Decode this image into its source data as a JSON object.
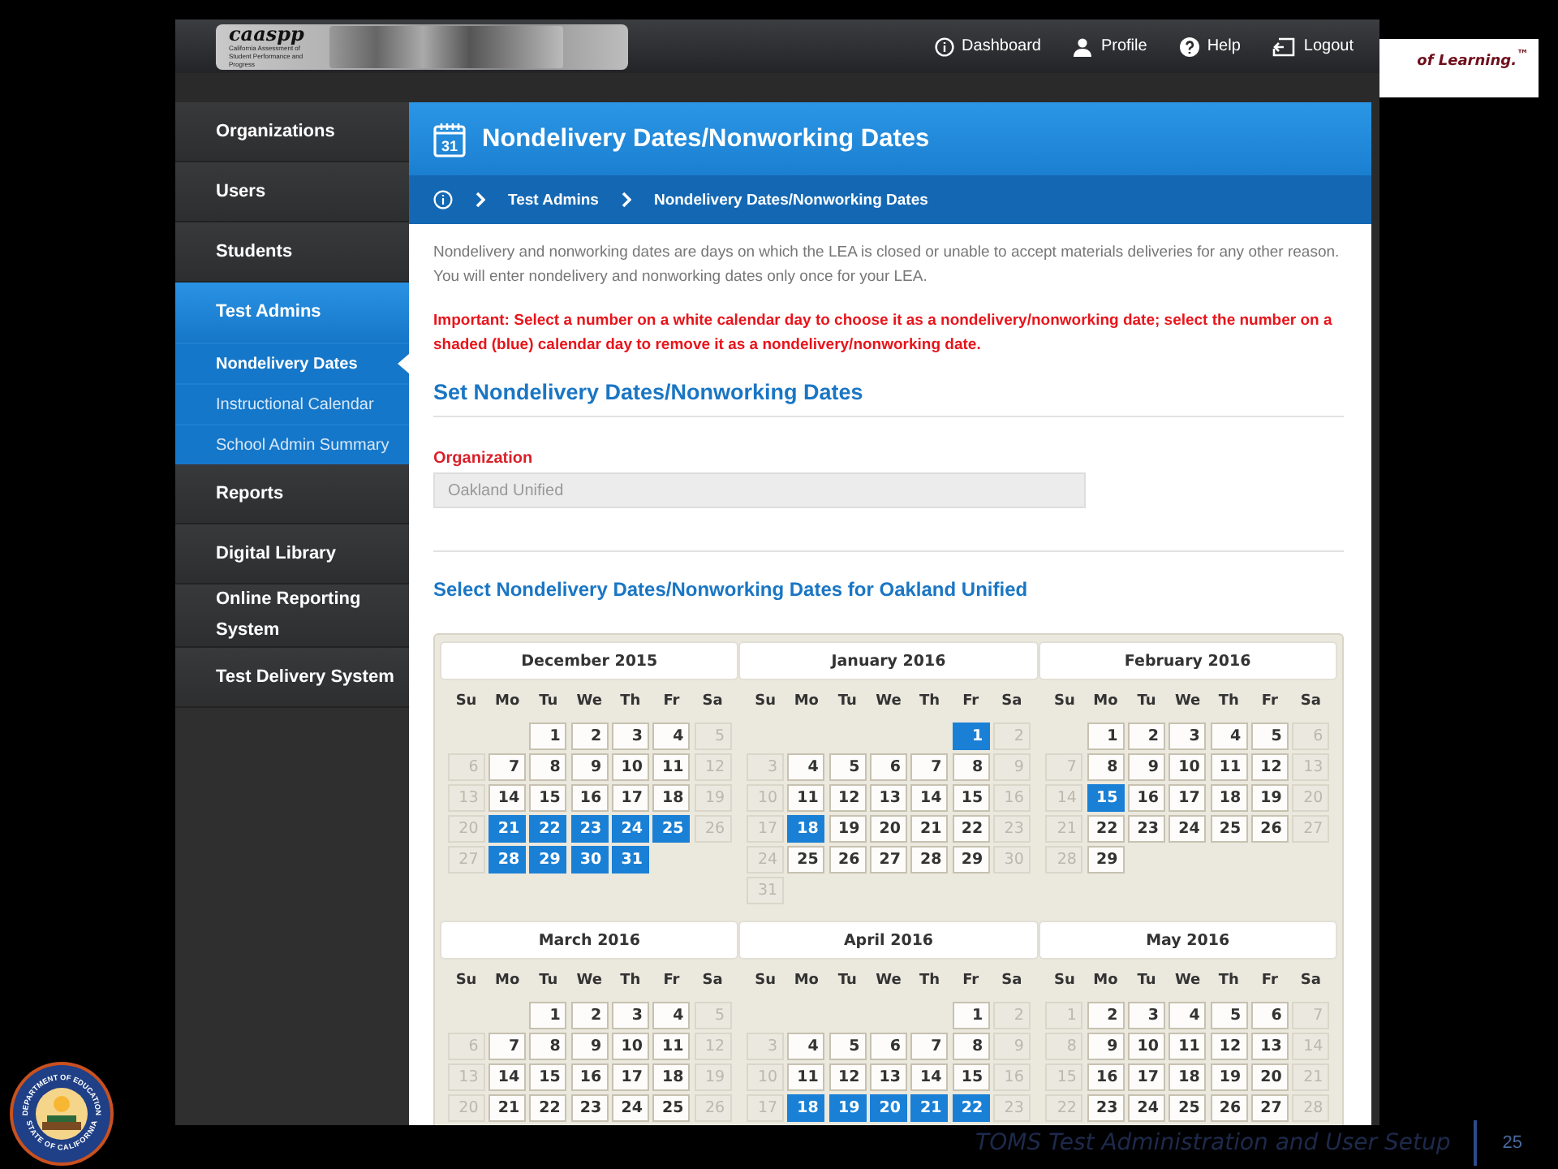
{
  "slide": {
    "brand_tagline": "of Learning.$^{™}$",
    "footer": "TOMS Test Administration and User Setup",
    "page_number": "25",
    "seal": {
      "top": "DEPARTMENT OF EDUCATION",
      "bottom": "STATE OF CALIFORNIA"
    }
  },
  "header": {
    "logo": "caaspp",
    "logo_subtitle": "California Assessment of Student Performance and Progress",
    "nav": [
      {
        "label": "Dashboard",
        "kind": "dashboard"
      },
      {
        "label": "Profile",
        "kind": "profile"
      },
      {
        "label": "Help",
        "kind": "help"
      },
      {
        "label": "Logout",
        "kind": "logout"
      }
    ]
  },
  "sidebar": {
    "items": [
      {
        "label": "Organizations",
        "selected": false
      },
      {
        "label": "Users",
        "selected": false
      },
      {
        "label": "Students",
        "selected": false
      },
      {
        "label": "Test Admins",
        "selected": true,
        "expanded": true,
        "children": [
          {
            "label": "Nondelivery Dates",
            "selected": true
          },
          {
            "label": "Instructional Calendar",
            "selected": false
          },
          {
            "label": "School Admin Summary",
            "selected": false
          }
        ]
      },
      {
        "label": "Reports",
        "selected": false
      },
      {
        "label": "Digital Library",
        "selected": false
      },
      {
        "label": "Online Reporting System",
        "selected": false
      },
      {
        "label": "Test Delivery System",
        "selected": false
      }
    ]
  },
  "page": {
    "title": "Nondelivery Dates/Nonworking Dates",
    "title_icon_day": "31",
    "breadcrumb": [
      "Test Admins",
      "Nondelivery Dates/Nonworking Dates"
    ],
    "intro": "Nondelivery and nonworking dates are days on which the LEA is closed or unable to accept materials deliveries for any other reason. You will enter nondelivery and nonworking dates only once for your LEA.",
    "important": "Important: Select a number on a white calendar day to choose it as a nondelivery/nonworking date; select the number on a shaded (blue) calendar day to remove it as a nondelivery/nonworking date.",
    "section_title": "Set Nondelivery Dates/Nonworking Dates",
    "organization": {
      "label": "Organization",
      "value": "Oakland Unified",
      "disabled": true
    },
    "calendar_title": "Select Nondelivery Dates/Nonworking Dates for Oakland Unified",
    "calendar": {
      "months": [
        {
          "title": "December 2015",
          "day_names": [
            "Su",
            "Mo",
            "Tu",
            "We",
            "Th",
            "Fr",
            "Sa"
          ],
          "weeks": [
            [
              {
                "kind": "blank"
              },
              {
                "kind": "blank"
              },
              {
                "kind": "day",
                "day": "1",
                "disabled": false,
                "selected": false
              },
              {
                "kind": "day",
                "day": "2",
                "disabled": false,
                "selected": false
              },
              {
                "kind": "day",
                "day": "3",
                "disabled": false,
                "selected": false
              },
              {
                "kind": "day",
                "day": "4",
                "disabled": false,
                "selected": false
              },
              {
                "kind": "day",
                "day": "5",
                "disabled": true,
                "selected": false
              }
            ],
            [
              {
                "kind": "day",
                "day": "6",
                "disabled": true,
                "selected": false
              },
              {
                "kind": "day",
                "day": "7",
                "disabled": false,
                "selected": false
              },
              {
                "kind": "day",
                "day": "8",
                "disabled": false,
                "selected": false
              },
              {
                "kind": "day",
                "day": "9",
                "disabled": false,
                "selected": false
              },
              {
                "kind": "day",
                "day": "10",
                "disabled": false,
                "selected": false
              },
              {
                "kind": "day",
                "day": "11",
                "disabled": false,
                "selected": false
              },
              {
                "kind": "day",
                "day": "12",
                "disabled": true,
                "selected": false
              }
            ],
            [
              {
                "kind": "day",
                "day": "13",
                "disabled": true,
                "selected": false
              },
              {
                "kind": "day",
                "day": "14",
                "disabled": false,
                "selected": false
              },
              {
                "kind": "day",
                "day": "15",
                "disabled": false,
                "selected": false
              },
              {
                "kind": "day",
                "day": "16",
                "disabled": false,
                "selected": false
              },
              {
                "kind": "day",
                "day": "17",
                "disabled": false,
                "selected": false
              },
              {
                "kind": "day",
                "day": "18",
                "disabled": false,
                "selected": false
              },
              {
                "kind": "day",
                "day": "19",
                "disabled": true,
                "selected": false
              }
            ],
            [
              {
                "kind": "day",
                "day": "20",
                "disabled": true,
                "selected": false
              },
              {
                "kind": "day",
                "day": "21",
                "disabled": false,
                "selected": true
              },
              {
                "kind": "day",
                "day": "22",
                "disabled": false,
                "selected": true
              },
              {
                "kind": "day",
                "day": "23",
                "disabled": false,
                "selected": true
              },
              {
                "kind": "day",
                "day": "24",
                "disabled": false,
                "selected": true
              },
              {
                "kind": "day",
                "day": "25",
                "disabled": false,
                "selected": true
              },
              {
                "kind": "day",
                "day": "26",
                "disabled": true,
                "selected": false
              }
            ],
            [
              {
                "kind": "day",
                "day": "27",
                "disabled": true,
                "selected": false
              },
              {
                "kind": "day",
                "day": "28",
                "disabled": false,
                "selected": true
              },
              {
                "kind": "day",
                "day": "29",
                "disabled": false,
                "selected": true
              },
              {
                "kind": "day",
                "day": "30",
                "disabled": false,
                "selected": true
              },
              {
                "kind": "day",
                "day": "31",
                "disabled": false,
                "selected": true
              }
            ]
          ]
        },
        {
          "title": "January 2016",
          "day_names": [
            "Su",
            "Mo",
            "Tu",
            "We",
            "Th",
            "Fr",
            "Sa"
          ],
          "weeks": [
            [
              {
                "kind": "blank"
              },
              {
                "kind": "blank"
              },
              {
                "kind": "blank"
              },
              {
                "kind": "blank"
              },
              {
                "kind": "blank"
              },
              {
                "kind": "day",
                "day": "1",
                "disabled": false,
                "selected": true
              },
              {
                "kind": "day",
                "day": "2",
                "disabled": true,
                "selected": false
              }
            ],
            [
              {
                "kind": "day",
                "day": "3",
                "disabled": true,
                "selected": false
              },
              {
                "kind": "day",
                "day": "4",
                "disabled": false,
                "selected": false
              },
              {
                "kind": "day",
                "day": "5",
                "disabled": false,
                "selected": false
              },
              {
                "kind": "day",
                "day": "6",
                "disabled": false,
                "selected": false
              },
              {
                "kind": "day",
                "day": "7",
                "disabled": false,
                "selected": false
              },
              {
                "kind": "day",
                "day": "8",
                "disabled": false,
                "selected": false
              },
              {
                "kind": "day",
                "day": "9",
                "disabled": true,
                "selected": false
              }
            ],
            [
              {
                "kind": "day",
                "day": "10",
                "disabled": true,
                "selected": false
              },
              {
                "kind": "day",
                "day": "11",
                "disabled": false,
                "selected": false
              },
              {
                "kind": "day",
                "day": "12",
                "disabled": false,
                "selected": false
              },
              {
                "kind": "day",
                "day": "13",
                "disabled": false,
                "selected": false
              },
              {
                "kind": "day",
                "day": "14",
                "disabled": false,
                "selected": false
              },
              {
                "kind": "day",
                "day": "15",
                "disabled": false,
                "selected": false
              },
              {
                "kind": "day",
                "day": "16",
                "disabled": true,
                "selected": false
              }
            ],
            [
              {
                "kind": "day",
                "day": "17",
                "disabled": true,
                "selected": false
              },
              {
                "kind": "day",
                "day": "18",
                "disabled": false,
                "selected": true
              },
              {
                "kind": "day",
                "day": "19",
                "disabled": false,
                "selected": false
              },
              {
                "kind": "day",
                "day": "20",
                "disabled": false,
                "selected": false
              },
              {
                "kind": "day",
                "day": "21",
                "disabled": false,
                "selected": false
              },
              {
                "kind": "day",
                "day": "22",
                "disabled": false,
                "selected": false
              },
              {
                "kind": "day",
                "day": "23",
                "disabled": true,
                "selected": false
              }
            ],
            [
              {
                "kind": "day",
                "day": "24",
                "disabled": true,
                "selected": false
              },
              {
                "kind": "day",
                "day": "25",
                "disabled": false,
                "selected": false
              },
              {
                "kind": "day",
                "day": "26",
                "disabled": false,
                "selected": false
              },
              {
                "kind": "day",
                "day": "27",
                "disabled": false,
                "selected": false
              },
              {
                "kind": "day",
                "day": "28",
                "disabled": false,
                "selected": false
              },
              {
                "kind": "day",
                "day": "29",
                "disabled": false,
                "selected": false
              },
              {
                "kind": "day",
                "day": "30",
                "disabled": true,
                "selected": false
              }
            ],
            [
              {
                "kind": "day",
                "day": "31",
                "disabled": true,
                "selected": false
              }
            ]
          ]
        },
        {
          "title": "February 2016",
          "day_names": [
            "Su",
            "Mo",
            "Tu",
            "We",
            "Th",
            "Fr",
            "Sa"
          ],
          "weeks": [
            [
              {
                "kind": "blank"
              },
              {
                "kind": "day",
                "day": "1",
                "disabled": false,
                "selected": false
              },
              {
                "kind": "day",
                "day": "2",
                "disabled": false,
                "selected": false
              },
              {
                "kind": "day",
                "day": "3",
                "disabled": false,
                "selected": false
              },
              {
                "kind": "day",
                "day": "4",
                "disabled": false,
                "selected": false
              },
              {
                "kind": "day",
                "day": "5",
                "disabled": false,
                "selected": false
              },
              {
                "kind": "day",
                "day": "6",
                "disabled": true,
                "selected": false
              }
            ],
            [
              {
                "kind": "day",
                "day": "7",
                "disabled": true,
                "selected": false
              },
              {
                "kind": "day",
                "day": "8",
                "disabled": false,
                "selected": false
              },
              {
                "kind": "day",
                "day": "9",
                "disabled": false,
                "selected": false
              },
              {
                "kind": "day",
                "day": "10",
                "disabled": false,
                "selected": false
              },
              {
                "kind": "day",
                "day": "11",
                "disabled": false,
                "selected": false
              },
              {
                "kind": "day",
                "day": "12",
                "disabled": false,
                "selected": false
              },
              {
                "kind": "day",
                "day": "13",
                "disabled": true,
                "selected": false
              }
            ],
            [
              {
                "kind": "day",
                "day": "14",
                "disabled": true,
                "selected": false
              },
              {
                "kind": "day",
                "day": "15",
                "disabled": false,
                "selected": true
              },
              {
                "kind": "day",
                "day": "16",
                "disabled": false,
                "selected": false
              },
              {
                "kind": "day",
                "day": "17",
                "disabled": false,
                "selected": false
              },
              {
                "kind": "day",
                "day": "18",
                "disabled": false,
                "selected": false
              },
              {
                "kind": "day",
                "day": "19",
                "disabled": false,
                "selected": false
              },
              {
                "kind": "day",
                "day": "20",
                "disabled": true,
                "selected": false
              }
            ],
            [
              {
                "kind": "day",
                "day": "21",
                "disabled": true,
                "selected": false
              },
              {
                "kind": "day",
                "day": "22",
                "disabled": false,
                "selected": false
              },
              {
                "kind": "day",
                "day": "23",
                "disabled": false,
                "selected": false
              },
              {
                "kind": "day",
                "day": "24",
                "disabled": false,
                "selected": false
              },
              {
                "kind": "day",
                "day": "25",
                "disabled": false,
                "selected": false
              },
              {
                "kind": "day",
                "day": "26",
                "disabled": false,
                "selected": false
              },
              {
                "kind": "day",
                "day": "27",
                "disabled": true,
                "selected": false
              }
            ],
            [
              {
                "kind": "day",
                "day": "28",
                "disabled": true,
                "selected": false
              },
              {
                "kind": "day",
                "day": "29",
                "disabled": false,
                "selected": false
              }
            ]
          ]
        },
        {
          "title": "March 2016",
          "day_names": [
            "Su",
            "Mo",
            "Tu",
            "We",
            "Th",
            "Fr",
            "Sa"
          ],
          "weeks": [
            [
              {
                "kind": "blank"
              },
              {
                "kind": "blank"
              },
              {
                "kind": "day",
                "day": "1",
                "disabled": false,
                "selected": false
              },
              {
                "kind": "day",
                "day": "2",
                "disabled": false,
                "selected": false
              },
              {
                "kind": "day",
                "day": "3",
                "disabled": false,
                "selected": false
              },
              {
                "kind": "day",
                "day": "4",
                "disabled": false,
                "selected": false
              },
              {
                "kind": "day",
                "day": "5",
                "disabled": true,
                "selected": false
              }
            ],
            [
              {
                "kind": "day",
                "day": "6",
                "disabled": true,
                "selected": false
              },
              {
                "kind": "day",
                "day": "7",
                "disabled": false,
                "selected": false
              },
              {
                "kind": "day",
                "day": "8",
                "disabled": false,
                "selected": false
              },
              {
                "kind": "day",
                "day": "9",
                "disabled": false,
                "selected": false
              },
              {
                "kind": "day",
                "day": "10",
                "disabled": false,
                "selected": false
              },
              {
                "kind": "day",
                "day": "11",
                "disabled": false,
                "selected": false
              },
              {
                "kind": "day",
                "day": "12",
                "disabled": true,
                "selected": false
              }
            ],
            [
              {
                "kind": "day",
                "day": "13",
                "disabled": true,
                "selected": false
              },
              {
                "kind": "day",
                "day": "14",
                "disabled": false,
                "selected": false
              },
              {
                "kind": "day",
                "day": "15",
                "disabled": false,
                "selected": false
              },
              {
                "kind": "day",
                "day": "16",
                "disabled": false,
                "selected": false
              },
              {
                "kind": "day",
                "day": "17",
                "disabled": false,
                "selected": false
              },
              {
                "kind": "day",
                "day": "18",
                "disabled": false,
                "selected": false
              },
              {
                "kind": "day",
                "day": "19",
                "disabled": true,
                "selected": false
              }
            ],
            [
              {
                "kind": "day",
                "day": "20",
                "disabled": true,
                "selected": false
              },
              {
                "kind": "day",
                "day": "21",
                "disabled": false,
                "selected": false
              },
              {
                "kind": "day",
                "day": "22",
                "disabled": false,
                "selected": false
              },
              {
                "kind": "day",
                "day": "23",
                "disabled": false,
                "selected": false
              },
              {
                "kind": "day",
                "day": "24",
                "disabled": false,
                "selected": false
              },
              {
                "kind": "day",
                "day": "25",
                "disabled": false,
                "selected": false
              },
              {
                "kind": "day",
                "day": "26",
                "disabled": true,
                "selected": false
              }
            ]
          ]
        },
        {
          "title": "April 2016",
          "day_names": [
            "Su",
            "Mo",
            "Tu",
            "We",
            "Th",
            "Fr",
            "Sa"
          ],
          "weeks": [
            [
              {
                "kind": "blank"
              },
              {
                "kind": "blank"
              },
              {
                "kind": "blank"
              },
              {
                "kind": "blank"
              },
              {
                "kind": "blank"
              },
              {
                "kind": "day",
                "day": "1",
                "disabled": false,
                "selected": false
              },
              {
                "kind": "day",
                "day": "2",
                "disabled": true,
                "selected": false
              }
            ],
            [
              {
                "kind": "day",
                "day": "3",
                "disabled": true,
                "selected": false
              },
              {
                "kind": "day",
                "day": "4",
                "disabled": false,
                "selected": false
              },
              {
                "kind": "day",
                "day": "5",
                "disabled": false,
                "selected": false
              },
              {
                "kind": "day",
                "day": "6",
                "disabled": false,
                "selected": false
              },
              {
                "kind": "day",
                "day": "7",
                "disabled": false,
                "selected": false
              },
              {
                "kind": "day",
                "day": "8",
                "disabled": false,
                "selected": false
              },
              {
                "kind": "day",
                "day": "9",
                "disabled": true,
                "selected": false
              }
            ],
            [
              {
                "kind": "day",
                "day": "10",
                "disabled": true,
                "selected": false
              },
              {
                "kind": "day",
                "day": "11",
                "disabled": false,
                "selected": false
              },
              {
                "kind": "day",
                "day": "12",
                "disabled": false,
                "selected": false
              },
              {
                "kind": "day",
                "day": "13",
                "disabled": false,
                "selected": false
              },
              {
                "kind": "day",
                "day": "14",
                "disabled": false,
                "selected": false
              },
              {
                "kind": "day",
                "day": "15",
                "disabled": false,
                "selected": false
              },
              {
                "kind": "day",
                "day": "16",
                "disabled": true,
                "selected": false
              }
            ],
            [
              {
                "kind": "day",
                "day": "17",
                "disabled": true,
                "selected": false
              },
              {
                "kind": "day",
                "day": "18",
                "disabled": false,
                "selected": true
              },
              {
                "kind": "day",
                "day": "19",
                "disabled": false,
                "selected": true
              },
              {
                "kind": "day",
                "day": "20",
                "disabled": false,
                "selected": true
              },
              {
                "kind": "day",
                "day": "21",
                "disabled": false,
                "selected": true
              },
              {
                "kind": "day",
                "day": "22",
                "disabled": false,
                "selected": true
              },
              {
                "kind": "day",
                "day": "23",
                "disabled": true,
                "selected": false
              }
            ]
          ]
        },
        {
          "title": "May 2016",
          "day_names": [
            "Su",
            "Mo",
            "Tu",
            "We",
            "Th",
            "Fr",
            "Sa"
          ],
          "weeks": [
            [
              {
                "kind": "day",
                "day": "1",
                "disabled": true,
                "selected": false
              },
              {
                "kind": "day",
                "day": "2",
                "disabled": false,
                "selected": false
              },
              {
                "kind": "day",
                "day": "3",
                "disabled": false,
                "selected": false
              },
              {
                "kind": "day",
                "day": "4",
                "disabled": false,
                "selected": false
              },
              {
                "kind": "day",
                "day": "5",
                "disabled": false,
                "selected": false
              },
              {
                "kind": "day",
                "day": "6",
                "disabled": false,
                "selected": false
              },
              {
                "kind": "day",
                "day": "7",
                "disabled": true,
                "selected": false
              }
            ],
            [
              {
                "kind": "day",
                "day": "8",
                "disabled": true,
                "selected": false
              },
              {
                "kind": "day",
                "day": "9",
                "disabled": false,
                "selected": false
              },
              {
                "kind": "day",
                "day": "10",
                "disabled": false,
                "selected": false
              },
              {
                "kind": "day",
                "day": "11",
                "disabled": false,
                "selected": false
              },
              {
                "kind": "day",
                "day": "12",
                "disabled": false,
                "selected": false
              },
              {
                "kind": "day",
                "day": "13",
                "disabled": false,
                "selected": false
              },
              {
                "kind": "day",
                "day": "14",
                "disabled": true,
                "selected": false
              }
            ],
            [
              {
                "kind": "day",
                "day": "15",
                "disabled": true,
                "selected": false
              },
              {
                "kind": "day",
                "day": "16",
                "disabled": false,
                "selected": false
              },
              {
                "kind": "day",
                "day": "17",
                "disabled": false,
                "selected": false
              },
              {
                "kind": "day",
                "day": "18",
                "disabled": false,
                "selected": false
              },
              {
                "kind": "day",
                "day": "19",
                "disabled": false,
                "selected": false
              },
              {
                "kind": "day",
                "day": "20",
                "disabled": false,
                "selected": false
              },
              {
                "kind": "day",
                "day": "21",
                "disabled": true,
                "selected": false
              }
            ],
            [
              {
                "kind": "day",
                "day": "22",
                "disabled": true,
                "selected": false
              },
              {
                "kind": "day",
                "day": "23",
                "disabled": false,
                "selected": false
              },
              {
                "kind": "day",
                "day": "24",
                "disabled": false,
                "selected": false
              },
              {
                "kind": "day",
                "day": "25",
                "disabled": false,
                "selected": false
              },
              {
                "kind": "day",
                "day": "26",
                "disabled": false,
                "selected": false
              },
              {
                "kind": "day",
                "day": "27",
                "disabled": false,
                "selected": false
              },
              {
                "kind": "day",
                "day": "28",
                "disabled": true,
                "selected": false
              }
            ]
          ]
        }
      ]
    }
  }
}
